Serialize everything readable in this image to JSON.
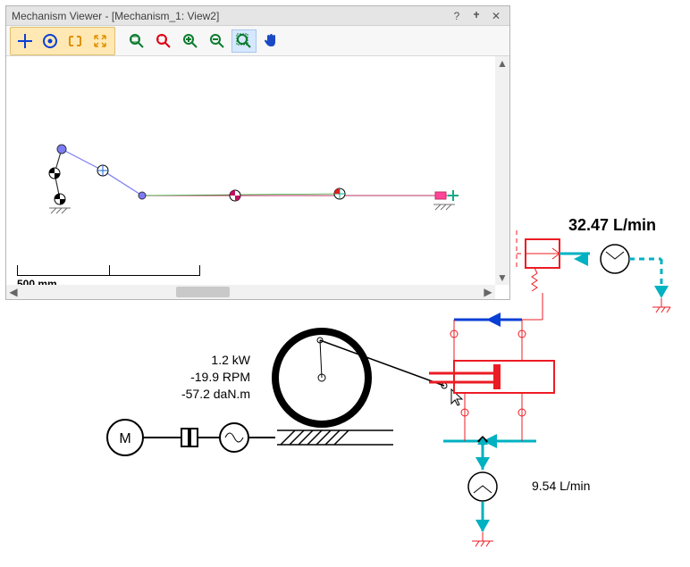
{
  "panel": {
    "title": "Mechanism Viewer - [Mechanism_1: View2]",
    "scale_label": "500 mm"
  },
  "winbuttons": {
    "help": "?",
    "pin": "📌",
    "close": "✕"
  },
  "tools": {
    "crosshair": "crosshair-icon",
    "target": "target-icon",
    "bracket": "bracket-icon",
    "expand": "expand-icon",
    "zoomfit": "zoom-fit-icon",
    "zoomwindow": "zoom-window-icon",
    "zoomin": "zoom-in-icon",
    "zoomout": "zoom-out-icon",
    "zoomselect": "zoom-select-icon",
    "pan": "pan-icon"
  },
  "readouts": {
    "flow_top": "32.47 L/min",
    "power": "1.2 kW",
    "speed": "-19.9 RPM",
    "torque": "-57.2 daN.m",
    "flow_bottom": "9.54 L/min"
  }
}
